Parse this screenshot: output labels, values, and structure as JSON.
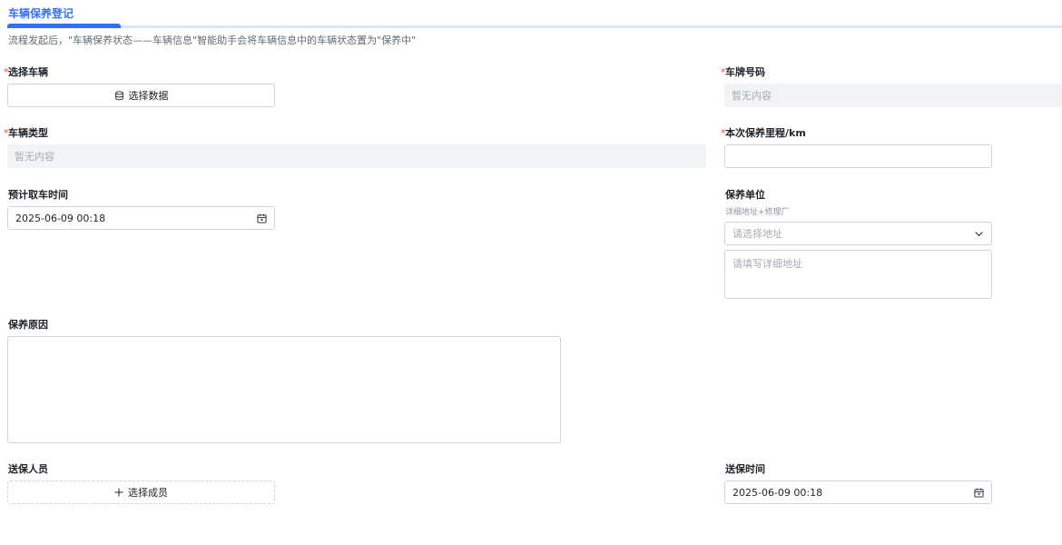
{
  "header": {
    "tab_label": "车辆保养登记",
    "description": "流程发起后，\"车辆保养状态——车辆信息\"智能助手会将车辆信息中的车辆状态置为\"保养中\""
  },
  "form": {
    "required_mark": "*",
    "vehicle": {
      "label": "选择车辆",
      "button_label": "选择数据",
      "icon": "database-icon"
    },
    "plate": {
      "label": "车牌号码",
      "empty_text": "暂无内容"
    },
    "vehicle_type": {
      "label": "车辆类型",
      "empty_text": "暂无内容"
    },
    "mileage": {
      "label": "本次保养里程/km",
      "value": ""
    },
    "pickup_time": {
      "label": "预计取车时间",
      "value": "2025-06-09 00:18",
      "icon": "calendar-icon"
    },
    "unit": {
      "label": "保养单位",
      "hint": "详细地址+修理厂",
      "address_placeholder": "请选择地址",
      "detail_placeholder": "请填写详细地址"
    },
    "reason": {
      "label": "保养原因",
      "value": ""
    },
    "sender": {
      "label": "送保人员",
      "button_label": "选择成员",
      "icon": "plus-icon"
    },
    "send_time": {
      "label": "送保时间",
      "value": "2025-06-09 00:18",
      "icon": "calendar-icon"
    }
  },
  "colors": {
    "accent": "#3370ff",
    "required": "#f54a45",
    "readonly_bg": "#f2f3f5",
    "border": "#d0d3d6"
  }
}
